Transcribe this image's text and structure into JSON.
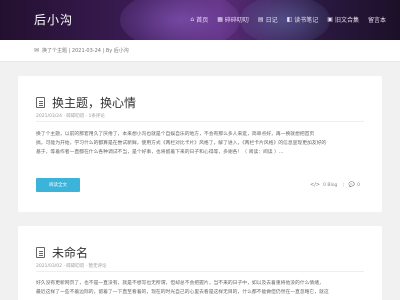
{
  "site": {
    "logo": "后小沟"
  },
  "nav": [
    {
      "icon": "⌂",
      "label": "首页"
    },
    {
      "icon": "▦",
      "label": "碎碎叨叨"
    },
    {
      "icon": "▤",
      "label": "日记"
    },
    {
      "icon": "◧",
      "label": "读书笔记"
    },
    {
      "icon": "▣",
      "label": "旧文合集"
    },
    {
      "icon": "",
      "label": "留言本"
    }
  ],
  "notice": {
    "icon": "✉",
    "text": "换了个主题 | 2021-03-24 | By 后小沟"
  },
  "posts": [
    {
      "title": "换主题，换心情",
      "meta": "2021/03/24 · 碎碎叨叨 · 1条评论",
      "excerpt": [
        "换了个主题，以前的那套用久了厌倦了，本来想小沟也就是个自娱自乐的地方，不会有那么多人来逛，简单点好，再一换就想把首页",
        "搞，可能为开始，学习什么的都算是在尝试新鲜，使用方式《两栏对比卡片》风格了，解了进入，《两栏卡片风格》的信息呈现更加友好的",
        "基于，等着作者一直都在什么各种调试不当，是个好事，也将留着下来的日子和心得等，多谢各！（ 阅读：阅读 ）..."
      ],
      "read_more": "阅读全文",
      "views": "0 Blog",
      "comments": "0"
    },
    {
      "title": "未命名",
      "meta": "2021/03/02 · 碎碎叨叨 · 暂无评论",
      "excerpt": [
        "好久没有更新网页了，也不是一直没有，就是不想写也无所谓，但却总不会把握片，当不来的日子中，如以及去着重将他没的什么情绪，",
        "最近这样了一些不着边际的，留着了一下直至看着的，现在的时光自己的心里去看是这样无目的，什么都不能做但仍然在一直忽略它，就这"
      ]
    }
  ]
}
